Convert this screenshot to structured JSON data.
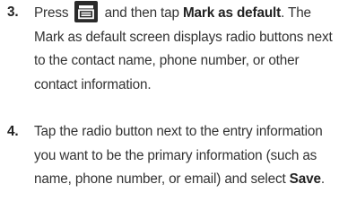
{
  "steps": [
    {
      "number": "3.",
      "text_before_icon": "Press",
      "icon": "menu-key-icon",
      "text_after_icon": "and then tap",
      "bold_1": "Mark as default",
      "text_rest": ". The Mark as default screen displays radio buttons next to the contact name, phone number, or other contact information."
    },
    {
      "number": "4.",
      "text_main": "Tap the radio button next to the entry information you want to be the primary information (such as name, phone number, or email) and select",
      "bold_1": "Save",
      "text_end": "."
    }
  ],
  "colors": {
    "text": "#333333",
    "icon_bg": "#2a2a2a"
  }
}
